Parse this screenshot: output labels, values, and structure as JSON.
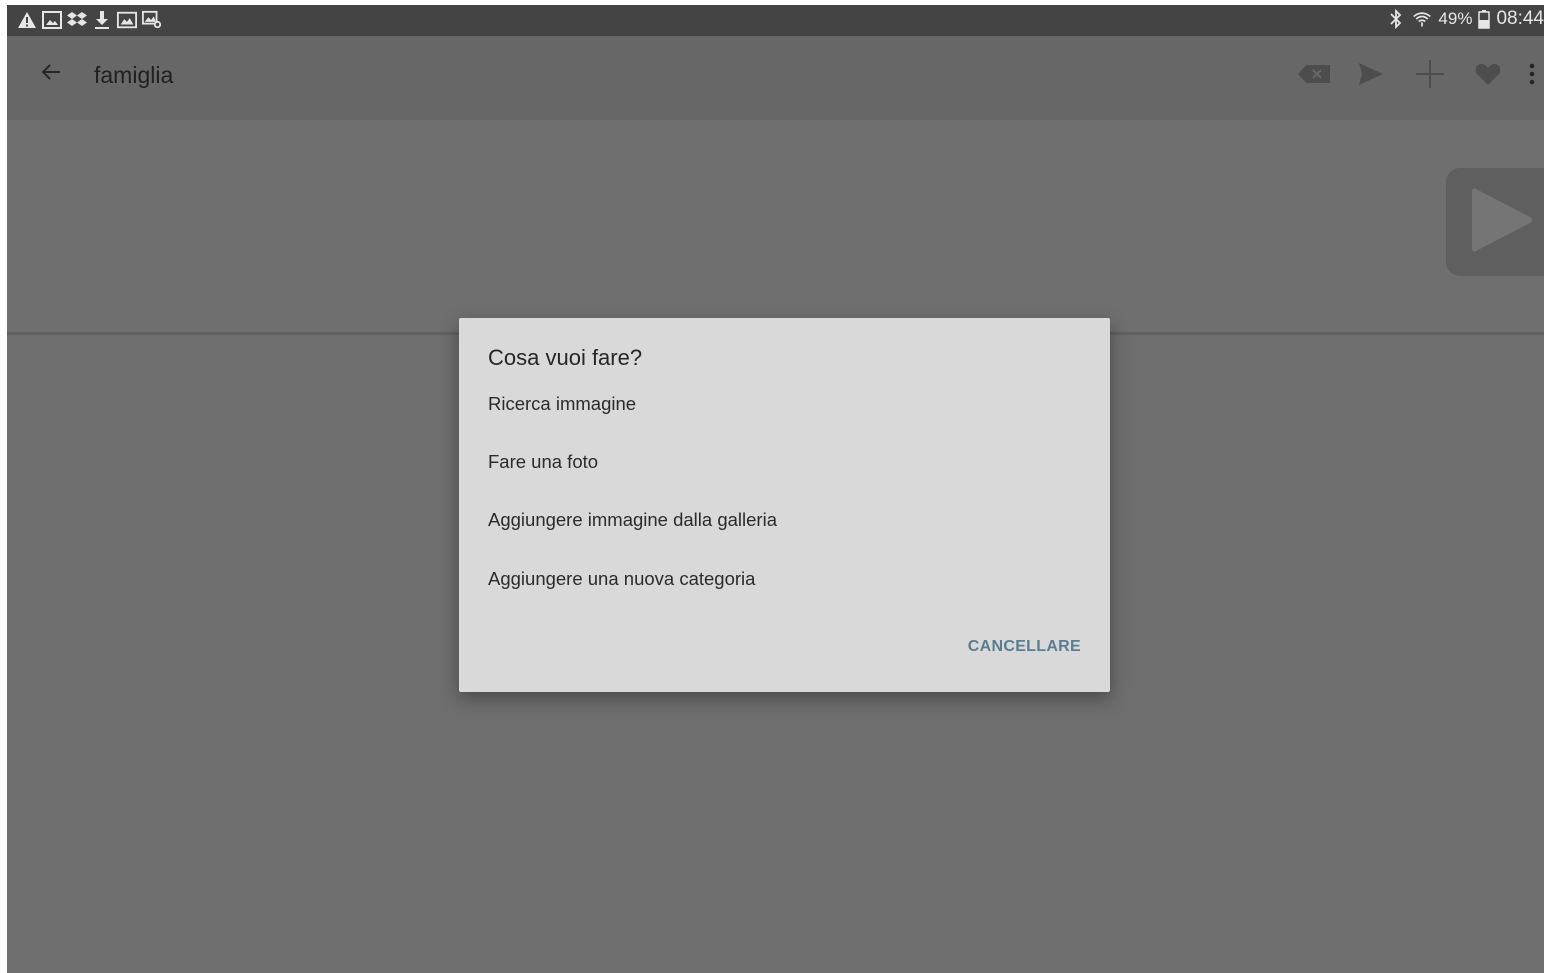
{
  "status_bar": {
    "left_icons": [
      "warning-icon",
      "image-icon",
      "dropbox-icon",
      "download-icon",
      "gallery-icon",
      "screenshot-icon"
    ],
    "bluetooth_icon": "bluetooth-icon",
    "wifi_icon": "wifi-icon",
    "battery_percent": "49%",
    "battery_icon": "battery-icon",
    "clock": "08:44"
  },
  "appbar": {
    "back_icon": "arrow-left-icon",
    "title": "famiglia",
    "actions": [
      "backspace-icon",
      "send-icon",
      "plus-icon",
      "heart-icon",
      "more-vert-icon"
    ]
  },
  "strip": {
    "play_icon": "play-icon"
  },
  "dialog": {
    "title": "Cosa vuoi fare?",
    "items": [
      "Ricerca immagine",
      "Fare una foto",
      "Aggiungere immagine dalla galleria",
      "Aggiungere una nuova categoria"
    ],
    "cancel_label": "CANCELLARE"
  },
  "colors": {
    "scrim": "#6e6e6e",
    "dialog_bg": "#d9d9d9",
    "accent": "#5b7d91"
  }
}
